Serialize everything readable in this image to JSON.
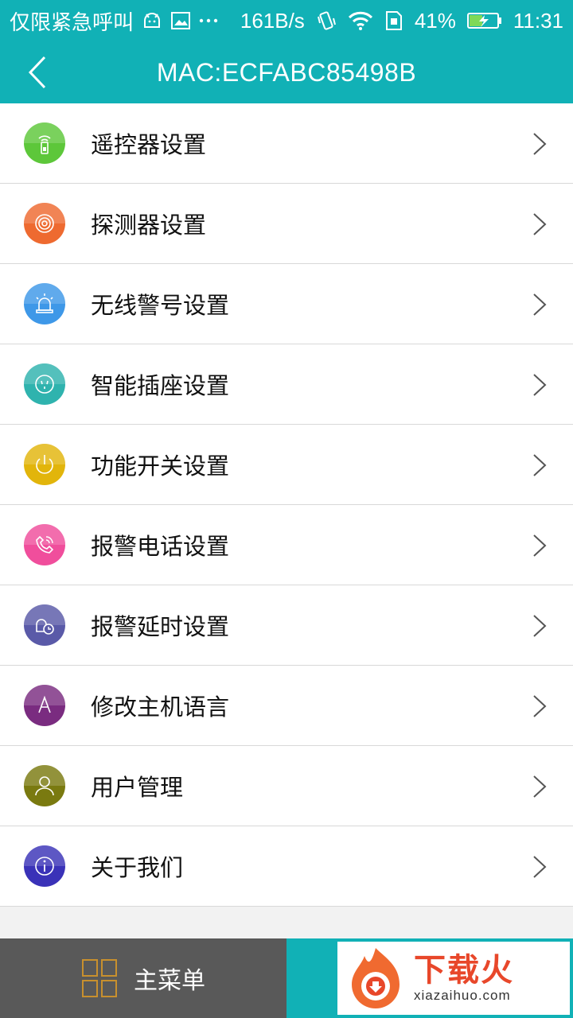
{
  "status_bar": {
    "carrier": "仅限紧急呼叫",
    "speed": "161B/s",
    "battery": "41%",
    "time": "11:31"
  },
  "header": {
    "title": "MAC:ECFABC85498B"
  },
  "menu": {
    "items": [
      {
        "label": "遥控器设置",
        "icon": "remote-icon",
        "color": "#5dc73a"
      },
      {
        "label": "探测器设置",
        "icon": "detector-icon",
        "color": "#ee6a30"
      },
      {
        "label": "无线警号设置",
        "icon": "siren-icon",
        "color": "#3e98e8"
      },
      {
        "label": "智能插座设置",
        "icon": "socket-icon",
        "color": "#2fb3ae"
      },
      {
        "label": "功能开关设置",
        "icon": "power-icon",
        "color": "#e2b50b"
      },
      {
        "label": "报警电话设置",
        "icon": "phone-icon",
        "color": "#f04e9c"
      },
      {
        "label": "报警延时设置",
        "icon": "delay-icon",
        "color": "#5a5aa8"
      },
      {
        "label": "修改主机语言",
        "icon": "language-icon",
        "color": "#7a2c80"
      },
      {
        "label": "用户管理",
        "icon": "user-icon",
        "color": "#7a7a10"
      },
      {
        "label": "关于我们",
        "icon": "info-icon",
        "color": "#3a32b8"
      }
    ]
  },
  "bottom_bar": {
    "main_menu_label": "主菜单",
    "watermark_big": "下载火",
    "watermark_small": "xiazaihuo.com"
  }
}
